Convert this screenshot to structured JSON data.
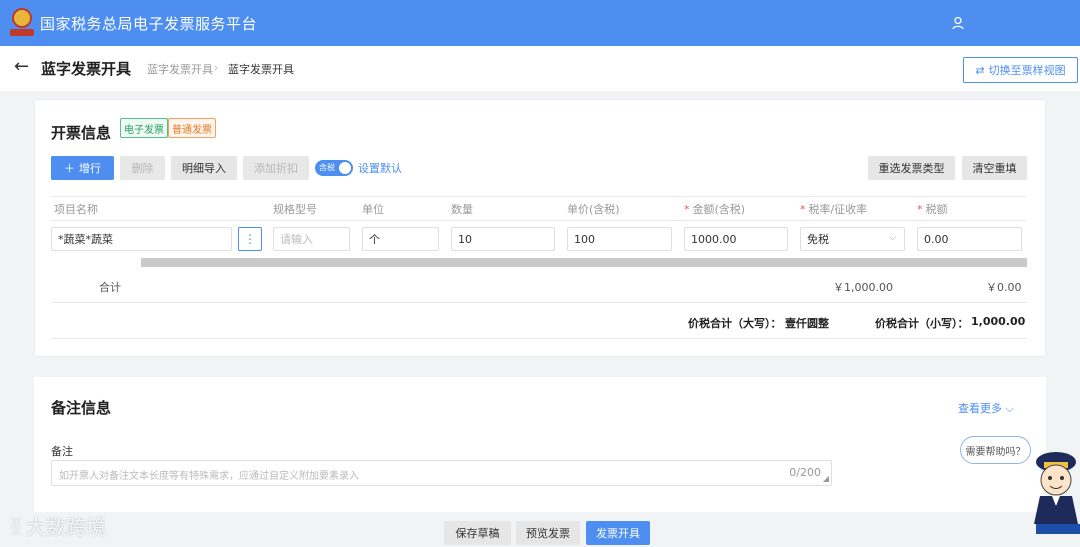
{
  "app": {
    "title": "国家税务总局电子发票服务平台",
    "logo_text": "国家税务"
  },
  "header": {
    "page_title": "蓝字发票开具",
    "breadcrumbs": [
      "蓝字发票开具",
      "蓝字发票开具"
    ],
    "switch_view_label": "切换至票样视图"
  },
  "invoice_info": {
    "title": "开票信息",
    "tags": [
      "电子发票",
      "普通发票"
    ],
    "buttons": {
      "add_row": "增行",
      "delete": "删除",
      "import_detail": "明细导入",
      "add_discount": "添加折扣",
      "reselect_type": "重选发票类型",
      "clear": "清空重填"
    },
    "tax_toggle": {
      "label": "含税",
      "on": true
    },
    "set_default": "设置默认",
    "columns": [
      "项目名称",
      "规格型号",
      "单位",
      "数量",
      "单价(含税)",
      "金额(含税)",
      "税率/征收率",
      "税额"
    ],
    "required_columns": [
      "金额(含税)",
      "税率/征收率",
      "税额"
    ],
    "rows": [
      {
        "item_name": "*蔬菜*蔬菜",
        "spec_placeholder": "请输入",
        "unit": "个",
        "quantity": "10",
        "unit_price": "100",
        "amount": "1000.00",
        "tax_rate": "免税",
        "tax_amount": "0.00"
      }
    ],
    "totals": {
      "label": "合计",
      "amount": "￥1,000.00",
      "tax": "￥0.00",
      "upper_label": "价税合计（大写）：",
      "upper_value": "壹仟圆整",
      "lower_label": "价税合计（小写）：",
      "lower_value": "1,000.00"
    }
  },
  "remark": {
    "section_title": "备注信息",
    "see_more": "查看更多",
    "field_label": "备注",
    "placeholder": "如开票人对备注文本长度等有特殊需求，应通过自定义附加要素录入",
    "counter": "0/200"
  },
  "footer": {
    "save_draft": "保存草稿",
    "preview": "预览发票",
    "issue": "发票开具"
  },
  "help": {
    "bubble": "需要帮助吗？"
  },
  "watermark": {
    "text": "大数跨境"
  },
  "colors": {
    "primary": "#4d8ef0",
    "required": "#e35d5d",
    "tag_green": "#2d9c63",
    "tag_orange": "#e07b2a"
  },
  "icons": [
    "logo-emblem-icon",
    "user-icon",
    "back-arrow-icon",
    "switch-view-icon",
    "plus-icon",
    "more-vertical-icon",
    "chevron-down-icon",
    "resize-icon",
    "mascot-icon"
  ]
}
